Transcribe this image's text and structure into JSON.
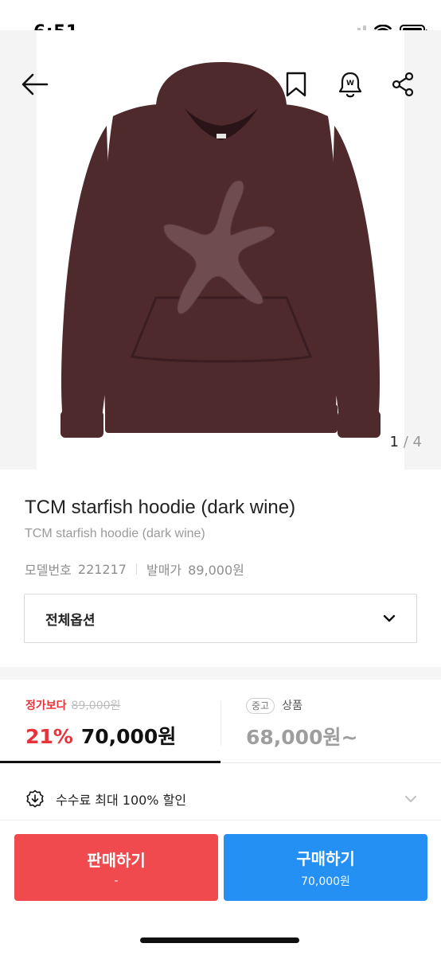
{
  "status_bar": {
    "time": "6:51"
  },
  "gallery": {
    "current_page": "1",
    "separator": "/",
    "total_pages": "4",
    "product_color": "#4e2a2d",
    "graphic_color": "#6e4c50"
  },
  "product": {
    "title": "TCM starfish hoodie (dark wine)",
    "subtitle": "TCM starfish hoodie (dark wine)",
    "model_label": "모델번호",
    "model_value": "221217",
    "release_price_label": "발매가",
    "release_price_value": "89,000원"
  },
  "options": {
    "label": "전체옵션"
  },
  "price": {
    "compare_label": "정가보다",
    "original_price": "89,000원",
    "discount": "21%",
    "current_price": "70,000원",
    "used_badge": "중고",
    "used_label": "상품",
    "used_price": "68,000원~"
  },
  "fee": {
    "text": "수수료 최대 100% 할인"
  },
  "actions": {
    "sell_label": "판매하기",
    "sell_sub": "-",
    "buy_label": "구매하기",
    "buy_sub": "70,000원"
  },
  "colors": {
    "accent_red": "#e5333b",
    "sell_button": "#f04a4e",
    "buy_button": "#2590f3"
  }
}
